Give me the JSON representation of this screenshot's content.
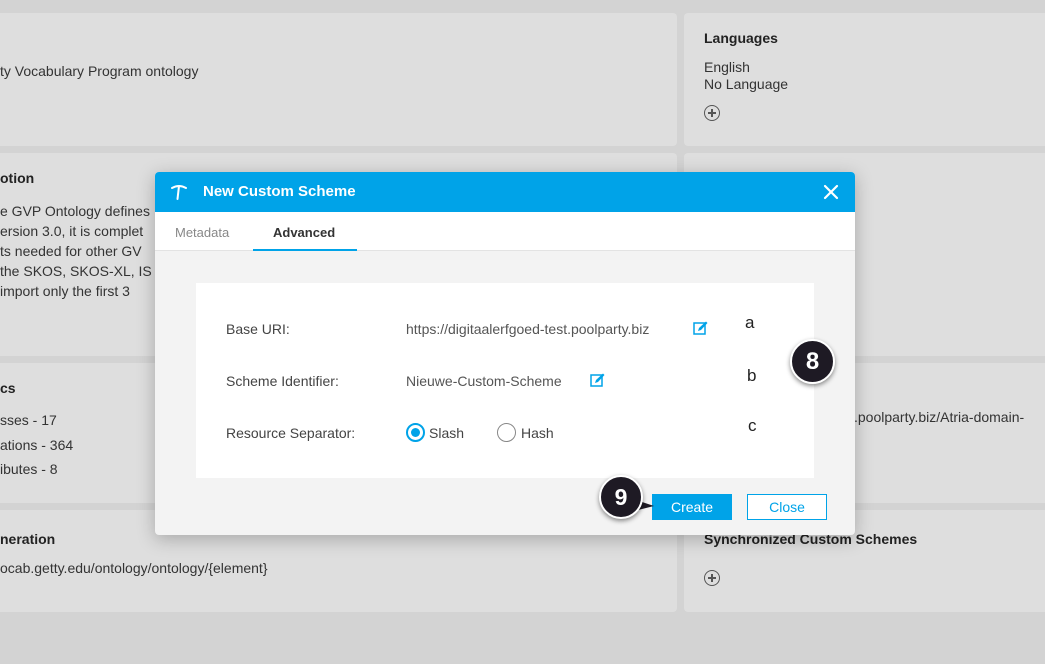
{
  "background": {
    "card1": {
      "text": "ty Vocabulary Program ontology"
    },
    "languages": {
      "title": "Languages",
      "items": [
        "English",
        "No Language"
      ]
    },
    "description": {
      "title": "otion",
      "lines": [
        "e GVP Ontology defines",
        "ersion 3.0, it is complet",
        "ts needed for other GV",
        "the SKOS, SKOS-XL, IS",
        "import only the first 3"
      ]
    },
    "statistics": {
      "title": "cs",
      "lines": [
        "sses - 17",
        "ations - 364",
        "ibutes - 8"
      ]
    },
    "uri_right": {
      "text": ".poolparty.biz/Atria-domain-"
    },
    "generation": {
      "title": "neration",
      "text": "ocab.getty.edu/ontology/ontology/{element}"
    },
    "sync": {
      "title": "Synchronized Custom Schemes"
    }
  },
  "modal": {
    "title": "New Custom Scheme",
    "tabs": [
      {
        "label": "Metadata",
        "active": false
      },
      {
        "label": "Advanced",
        "active": true
      }
    ],
    "fields": {
      "base_uri": {
        "label": "Base URI:",
        "value": "https://digitaalerfgoed-test.poolparty.biz"
      },
      "scheme_identifier": {
        "label": "Scheme Identifier:",
        "value": "Nieuwe-Custom-Scheme"
      },
      "resource_separator": {
        "label": "Resource Separator:",
        "options": [
          {
            "label": "Slash",
            "checked": true
          },
          {
            "label": "Hash",
            "checked": false
          }
        ]
      }
    },
    "buttons": {
      "create": "Create",
      "close": "Close"
    }
  },
  "annotations": {
    "letters": [
      "a",
      "b",
      "c"
    ],
    "badge_8": "8",
    "badge_9": "9"
  },
  "colors": {
    "accent": "#00a3e8",
    "badge": "#1e1a24",
    "backdrop": "#d3d3d3"
  }
}
